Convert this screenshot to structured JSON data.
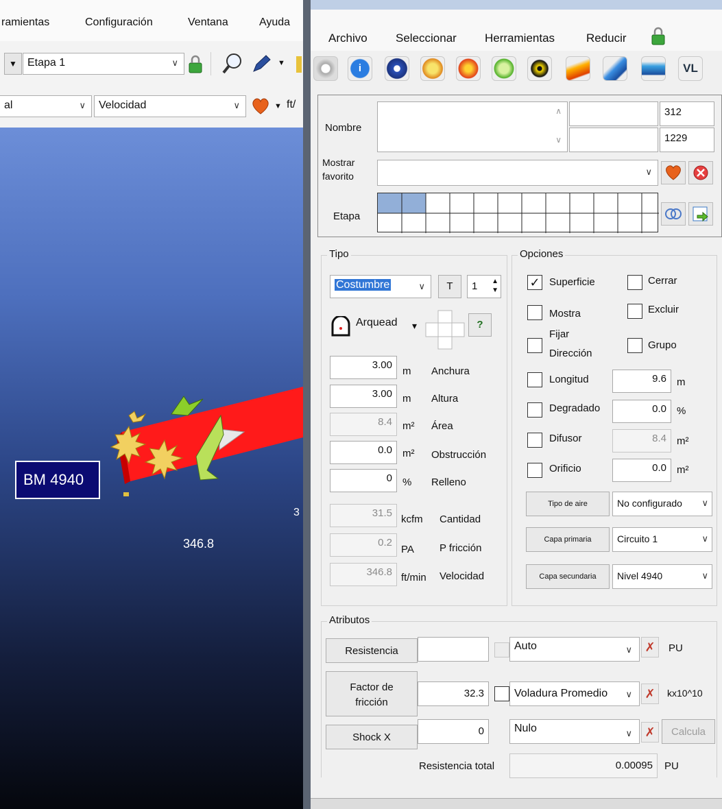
{
  "left_window": {
    "menu": [
      "ramientas",
      "Configuración",
      "Ventana",
      "Ayuda"
    ],
    "stage_combo": "Etapa 1",
    "row2_combo_a": "al",
    "row2_combo_b": "Velocidad",
    "unit_partial": "ft/",
    "viewport": {
      "node_label": "BM 4940",
      "velocity_value": "346.8",
      "edge_value_partial": "3"
    }
  },
  "panel": {
    "menu": [
      "Archivo",
      "Seleccionar",
      "Herramientas",
      "Reducir"
    ],
    "toolbar_icons": [
      "disc-icon",
      "info-icon",
      "fan-icon",
      "heat-icon",
      "fire-icon",
      "speech-bubble-icon",
      "radiation-icon",
      "flame-icon",
      "wifi-icon",
      "layers-icon",
      "logo-icon"
    ],
    "header": {
      "nombre_label": "Nombre",
      "nombre_value": "",
      "id_top": "312",
      "id_bottom": "1229",
      "favorito_label_1": "Mostrar",
      "favorito_label_2": "favorito",
      "favorito_value": "",
      "etapa_label": "Etapa"
    },
    "tipo": {
      "title": "Tipo",
      "tipo_combo": "Costumbre",
      "t_button": "T",
      "stepper_value": "1",
      "shape_combo": "Arquead",
      "help_button": "?",
      "rows": [
        {
          "value": "3.00",
          "unit": "m",
          "label": "Anchura",
          "disabled": false
        },
        {
          "value": "3.00",
          "unit": "m",
          "label": "Altura",
          "disabled": false
        },
        {
          "value": "8.4",
          "unit": "m²",
          "label": "Área",
          "disabled": true
        },
        {
          "value": "0.0",
          "unit": "m²",
          "label": "Obstrucción",
          "disabled": false
        },
        {
          "value": "0",
          "unit": "%",
          "label": "Relleno",
          "disabled": false
        }
      ],
      "calc_rows": [
        {
          "value": "31.5",
          "unit": "kcfm",
          "label": "Cantidad"
        },
        {
          "value": "0.2",
          "unit": "PA",
          "label": "P fricción"
        },
        {
          "value": "346.8",
          "unit": "ft/min",
          "label": "Velocidad"
        }
      ]
    },
    "opciones": {
      "title": "Opciones",
      "superficie": "Superficie",
      "cerrar": "Cerrar",
      "mostra": "Mostra",
      "excluir": "Excluir",
      "fijar_1": "Fijar",
      "fijar_2": "Dirección",
      "grupo": "Grupo",
      "longitud": "Longitud",
      "longitud_value": "9.6",
      "longitud_unit": "m",
      "degradado": "Degradado",
      "degradado_value": "0.0",
      "degradado_unit": "%",
      "difusor": "Difusor",
      "difusor_value": "8.4",
      "difusor_unit": "m²",
      "orificio": "Orificio",
      "orificio_value": "0.0",
      "orificio_unit": "m²",
      "tipo_aire_btn": "Tipo de aire",
      "tipo_aire_value": "No configurado",
      "capa_primaria_btn": "Capa primaria",
      "capa_primaria_value": "Circuito 1",
      "capa_secundaria_btn": "Capa secundaria",
      "capa_secundaria_value": "Nivel 4940"
    },
    "atributos": {
      "title": "Atributos",
      "resistencia_btn": "Resistencia",
      "resistencia_value": "",
      "resistencia_combo": "Auto",
      "resistencia_unit": "PU",
      "friccion_btn_1": "Factor de",
      "friccion_btn_2": "fricción",
      "friccion_value": "32.3",
      "friccion_combo": "Voladura Promedio",
      "friccion_unit": "kx10^10",
      "shock_btn": "Shock X",
      "shock_value": "0",
      "shock_combo": "Nulo",
      "calcula": "Calcula",
      "total_label": "Resistencia total",
      "total_value": "0.00095",
      "total_unit": "PU"
    }
  }
}
